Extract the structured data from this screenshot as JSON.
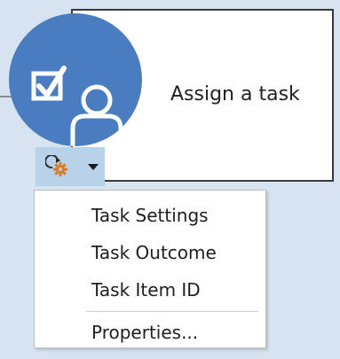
{
  "diagram": {
    "task_label": "Assign a task",
    "task_icon": "task-assign-icon",
    "action_icon": "gear-refresh-icon"
  },
  "menu": {
    "items": [
      {
        "label": "Task Settings"
      },
      {
        "label": "Task Outcome"
      },
      {
        "label": "Task Item ID"
      },
      {
        "label": "Properties..."
      }
    ]
  },
  "colors": {
    "background": "#d6e3f0",
    "circle": "#4a7dc0",
    "action_button": "#b8d2ea",
    "gear": "#e07a1f"
  }
}
